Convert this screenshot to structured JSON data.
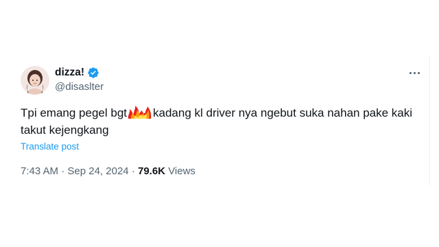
{
  "author": {
    "display_name": "dizza!",
    "handle": "@disaslter",
    "verified": true
  },
  "tweet": {
    "text_before": "Tpi emang pegel bgt",
    "text_after": "kadang kl driver nya ngebut suka nahan pake kaki takut kejengkang",
    "censor_icon": "fire-censor-icon"
  },
  "actions": {
    "translate_label": "Translate post",
    "more_icon": "more-options-icon"
  },
  "meta": {
    "time": "7:43 AM",
    "separator": "·",
    "date": "Sep 24, 2024",
    "views_count": "79.6K",
    "views_label": "Views"
  },
  "colors": {
    "accent": "#1d9bf0",
    "text": "#0f1419",
    "secondary": "#536471"
  }
}
